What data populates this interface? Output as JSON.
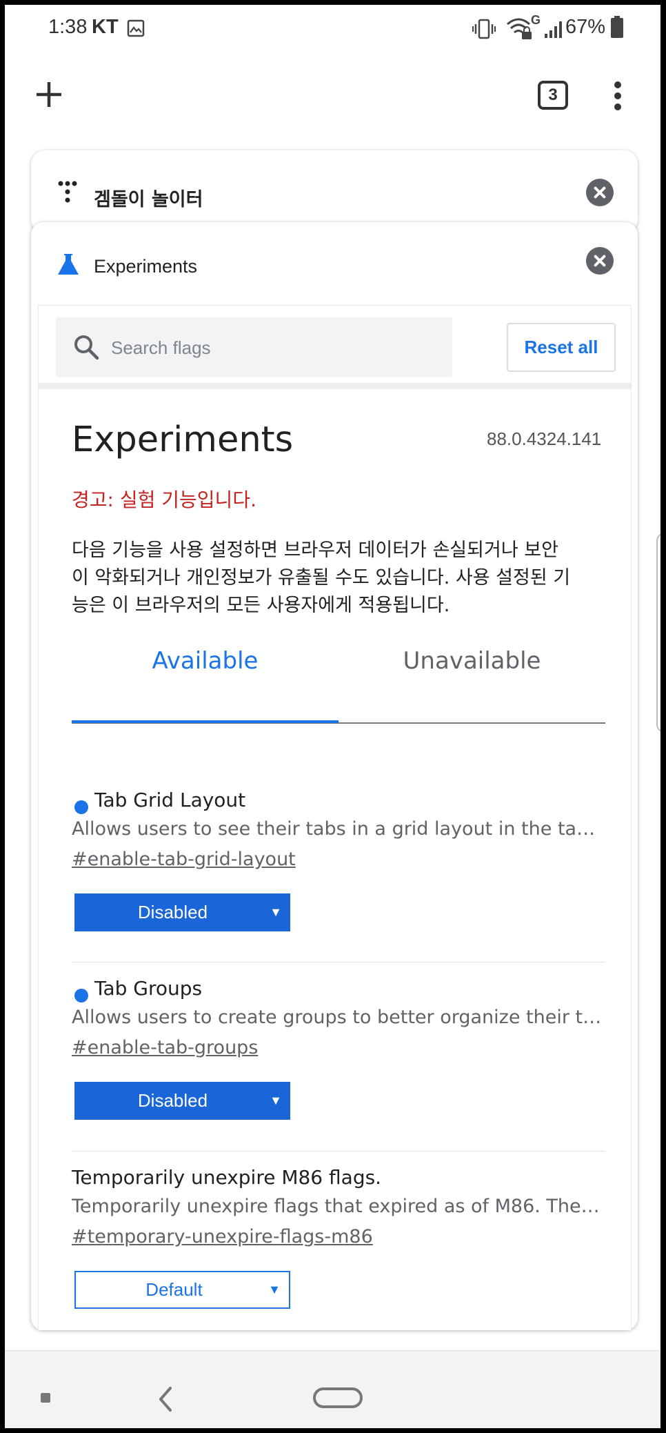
{
  "status_bar": {
    "time": "1:38",
    "carrier": "KT",
    "network_type": "G",
    "battery": "67%",
    "icons": [
      "gallery-icon",
      "vibrate-icon",
      "wifi-icon",
      "signal-icon",
      "battery-icon"
    ]
  },
  "toolbar": {
    "new_tab_icon": "plus-icon",
    "tab_count": "3",
    "menu_icon": "more-vert-icon"
  },
  "tabs": {
    "back_card": {
      "title": "겜돌이 놀이터",
      "icon": "dots-logo-icon"
    },
    "front_card": {
      "title": "Experiments",
      "icon": "flask-icon"
    }
  },
  "flags_page": {
    "search": {
      "placeholder": "Search flags"
    },
    "reset_all_label": "Reset all",
    "heading": "Experiments",
    "version": "88.0.4324.141",
    "warning": "경고: 실험 기능입니다.",
    "description_lines": [
      "다음 기능을 사용 설정하면 브라우저 데이터가 손실되거나 보안",
      "이 악화되거나 개인정보가 유출될 수도 있습니다. 사용 설정된 기",
      "능은 이 브라우저의 모든 사용자에게 적용됩니다."
    ],
    "tab_available": "Available",
    "tab_unavailable": "Unavailable",
    "active_tab": "Available",
    "flags": [
      {
        "name": "Tab Grid Layout",
        "modified": true,
        "description": "Allows users to see their tabs in a grid layout in the tab s…",
        "link": "#enable-tab-grid-layout",
        "value": "Disabled"
      },
      {
        "name": "Tab Groups",
        "modified": true,
        "description": "Allows users to create groups to better organize their tab…",
        "link": "#enable-tab-groups",
        "value": "Disabled"
      },
      {
        "name": "Temporarily unexpire M86 flags.",
        "modified": false,
        "description": "Temporarily unexpire flags that expired as of M86. These…",
        "link": "#temporary-unexpire-flags-m86",
        "value": "Default"
      }
    ]
  },
  "colors": {
    "accent": "#1a73e8",
    "warning": "#c5221f",
    "select_active": "#1a66d9"
  }
}
